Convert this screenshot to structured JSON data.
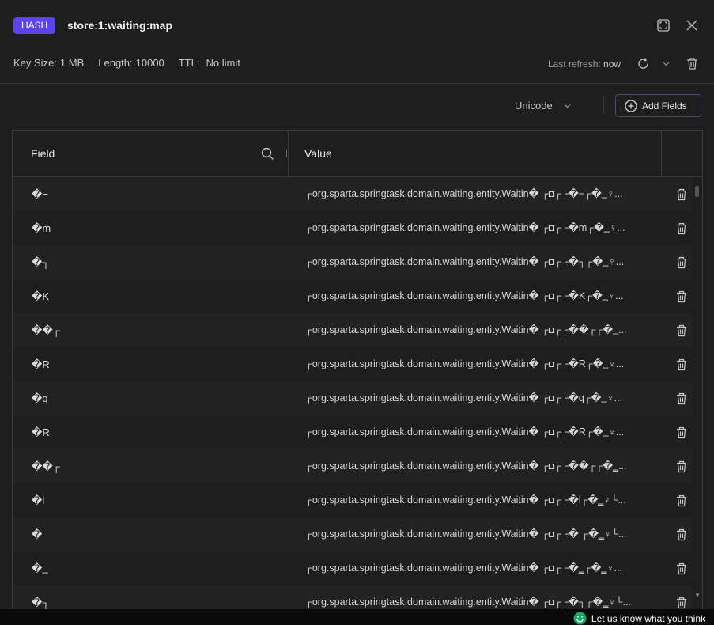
{
  "header": {
    "type_badge": "HASH",
    "key_name": "store:1:waiting:map"
  },
  "meta": {
    "key_size_label": "Key Size:",
    "key_size_value": "1 MB",
    "length_label": "Length:",
    "length_value": "10000",
    "ttl_label": "TTL:",
    "ttl_value": "No limit",
    "last_refresh_label": "Last refresh:",
    "last_refresh_value": "now"
  },
  "toolbar": {
    "encoding": "Unicode",
    "add_fields_label": "Add Fields"
  },
  "table": {
    "col_field": "Field",
    "col_value": "Value",
    "rows": [
      {
        "field": "�−",
        "value": "┌org.sparta.springtask.domain.waiting.entity.Waitin� ┌◘┌┌�−┌�‗♀..."
      },
      {
        "field": "�m",
        "value": "┌org.sparta.springtask.domain.waiting.entity.Waitin� ┌◘┌┌�m┌�‗♀..."
      },
      {
        "field": "�┐",
        "value": "┌org.sparta.springtask.domain.waiting.entity.Waitin� ┌◘┌┌�┐┌�‗♀..."
      },
      {
        "field": "�K",
        "value": "┌org.sparta.springtask.domain.waiting.entity.Waitin� ┌◘┌┌�K┌�‗♀..."
      },
      {
        "field": "��┌",
        "value": "┌org.sparta.springtask.domain.waiting.entity.Waitin� ┌◘┌┌��┌┌�‗..."
      },
      {
        "field": "�R",
        "value": "┌org.sparta.springtask.domain.waiting.entity.Waitin� ┌◘┌┌�R┌�‗♀..."
      },
      {
        "field": "�q",
        "value": "┌org.sparta.springtask.domain.waiting.entity.Waitin� ┌◘┌┌�q┌�‗♀..."
      },
      {
        "field": "�R",
        "value": "┌org.sparta.springtask.domain.waiting.entity.Waitin� ┌◘┌┌�R┌�‗♀..."
      },
      {
        "field": "��┌",
        "value": "┌org.sparta.springtask.domain.waiting.entity.Waitin� ┌◘┌┌��┌┌�‗..."
      },
      {
        "field": "�l",
        "value": "┌org.sparta.springtask.domain.waiting.entity.Waitin� ┌◘┌┌�l┌�‗♀└..."
      },
      {
        "field": "�",
        "value": "┌org.sparta.springtask.domain.waiting.entity.Waitin� ┌◘┌┌� ┌�‗♀└..."
      },
      {
        "field": "�‗",
        "value": "┌org.sparta.springtask.domain.waiting.entity.Waitin� ┌◘┌┌�‗┌�‗♀..."
      },
      {
        "field": "�┐",
        "value": "┌org.sparta.springtask.domain.waiting.entity.Waitin� ┌◘┌┌�┐┌�‗♀└..."
      }
    ]
  },
  "footer": {
    "feedback_label": "Let us know what you think"
  },
  "colors": {
    "badge": "#5b44f0",
    "background": "#1e1e1e",
    "feedback_icon": "#1aa86a"
  }
}
